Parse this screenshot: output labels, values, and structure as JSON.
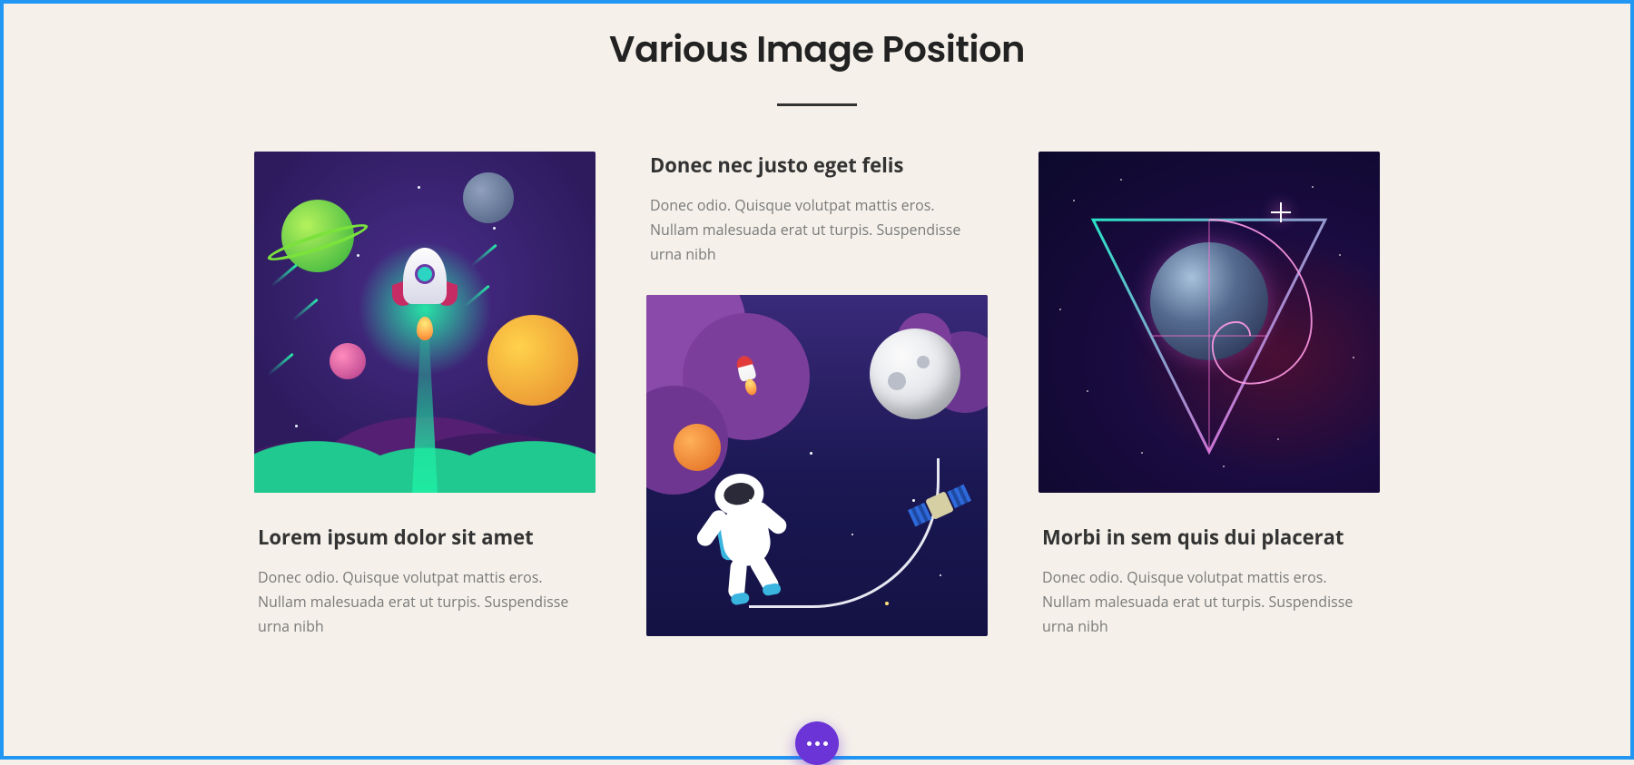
{
  "section": {
    "title": "Various Image Position"
  },
  "cards": [
    {
      "layout": "image-top",
      "title": "Lorem ipsum dolor sit amet",
      "body": "Donec odio. Quisque volutpat mattis eros. Nullam malesuada erat ut turpis. Suspendisse urna nibh"
    },
    {
      "layout": "image-bottom",
      "title": "Donec nec justo eget felis",
      "body": "Donec odio. Quisque volutpat mattis eros. Nullam malesuada erat ut turpis. Suspendisse urna nibh"
    },
    {
      "layout": "image-top",
      "title": "Morbi in sem quis dui placerat",
      "body": "Donec odio. Quisque volutpat mattis eros. Nullam malesuada erat ut turpis. Suspendisse urna nibh"
    }
  ],
  "fab": {
    "icon": "more-horizontal"
  }
}
